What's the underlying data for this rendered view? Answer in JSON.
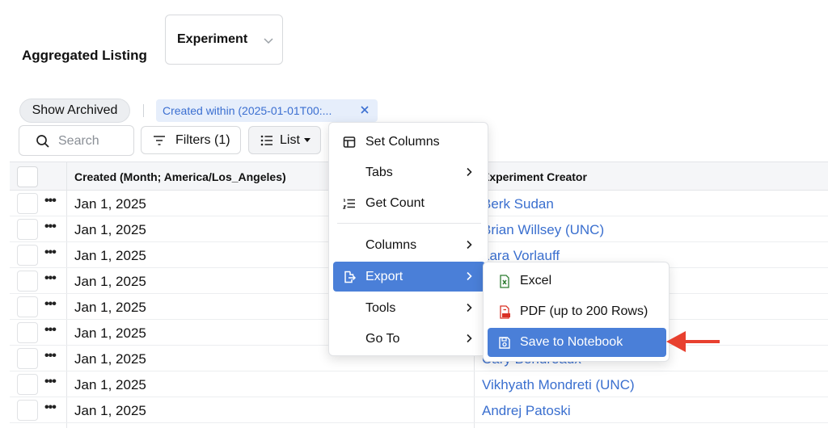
{
  "header": {
    "title": "Aggregated Listing",
    "entity_select": "Experiment"
  },
  "filterbar": {
    "show_archived": "Show Archived",
    "active_filter": "Created within (2025-01-01T00:..."
  },
  "toolbar": {
    "search_placeholder": "Search",
    "filters": "Filters (1)",
    "view": "List"
  },
  "table": {
    "columns": [
      "Created (Month; America/Los_Angeles)",
      "Experiment Creator"
    ],
    "rows": [
      {
        "created": "Jan 1, 2025",
        "creator": "Berk Sudan"
      },
      {
        "created": "Jan 1, 2025",
        "creator": "Brian Willsey (UNC)"
      },
      {
        "created": "Jan 1, 2025",
        "creator": "Lara Vorlauff"
      },
      {
        "created": "Jan 1, 2025",
        "creator": ""
      },
      {
        "created": "Jan 1, 2025",
        "creator": ""
      },
      {
        "created": "Jan 1, 2025",
        "creator": ""
      },
      {
        "created": "Jan 1, 2025",
        "creator": "Cary Bendreaux"
      },
      {
        "created": "Jan 1, 2025",
        "creator": "Vikhyath Mondreti (UNC)"
      },
      {
        "created": "Jan 1, 2025",
        "creator": "Andrej Patoski"
      }
    ]
  },
  "menu": {
    "items": [
      {
        "label": "Set Columns",
        "icon": "table-icon"
      },
      {
        "label": "Tabs",
        "submenu": true
      },
      {
        "label": "Get Count",
        "icon": "list-count-icon"
      },
      {
        "label": "Columns",
        "submenu": true
      },
      {
        "label": "Export",
        "icon": "export-file-icon",
        "submenu": true,
        "active": true
      },
      {
        "label": "Tools",
        "submenu": true
      },
      {
        "label": "Go To",
        "submenu": true
      }
    ]
  },
  "export_submenu": {
    "items": [
      {
        "label": "Excel",
        "icon": "excel-file-icon"
      },
      {
        "label": "PDF (up to 200 Rows)",
        "icon": "pdf-file-icon"
      },
      {
        "label": "Save to Notebook",
        "icon": "save-icon",
        "active": true
      }
    ]
  },
  "colors": {
    "accent": "#4a7fd8",
    "link": "#3a6fcf",
    "annotation_arrow": "#e8402f"
  }
}
